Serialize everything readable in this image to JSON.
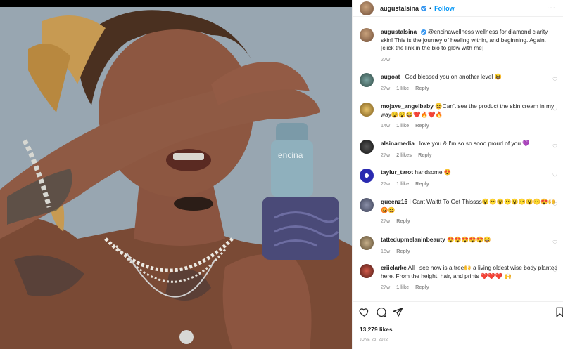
{
  "post": {
    "author": "augustalsina",
    "follow_label": "Follow",
    "more_label": "···",
    "dot": "•",
    "likes": "13,279 likes",
    "date": "JUNE 23, 2022"
  },
  "caption": {
    "username": "augustalsina",
    "text": "@encinawellness wellness for diamond clarity skin! This is the journey of healing within, and beginning. Again. [click the link in the bio to glow with me]",
    "time": "27w"
  },
  "comments": [
    {
      "username": "augoat_",
      "text": "God blessed you on another level 😆",
      "time": "27w",
      "likes": "1 like",
      "reply": "Reply"
    },
    {
      "username": "mojave_angelbaby",
      "text": "😆Can't see the product the skin cream in my way😵😵😆❤️🔥❤️🔥",
      "time": "14w",
      "likes": "1 like",
      "reply": "Reply"
    },
    {
      "username": "alsinamedia",
      "text": "I love you & I'm so so sooo proud of you 💜",
      "time": "27w",
      "likes": "2 likes",
      "reply": "Reply"
    },
    {
      "username": "taylur_tarot",
      "text": "handsome 😍",
      "time": "27w",
      "likes": "1 like",
      "reply": "Reply"
    },
    {
      "username": "queenz16",
      "text": "I Cant Waittt To Get Thissss😮😶😮😶😮😶😮😶😍🙌😡😆",
      "time": "27w",
      "likes": "",
      "reply": "Reply"
    },
    {
      "username": "tattedupmelaninbeauty",
      "text": "😍😍😍😍😍😆",
      "time": "15w",
      "likes": "",
      "reply": "Reply"
    },
    {
      "username": "eriiclarke",
      "text": "All I see now is a tree🙌 a living oldest wise body planted here. From the height, hair, and prints ❤️❤️❤️ 🙌",
      "time": "27w",
      "likes": "1 like",
      "reply": "Reply"
    }
  ],
  "photo": {
    "brand_label": "encina"
  },
  "colors": {
    "follow": "#0095f6",
    "meta": "#8e8e8e",
    "verified": "#3897f0"
  },
  "icons": [
    "heart-icon",
    "comment-icon",
    "share-icon",
    "bookmark-icon",
    "verified-icon"
  ]
}
